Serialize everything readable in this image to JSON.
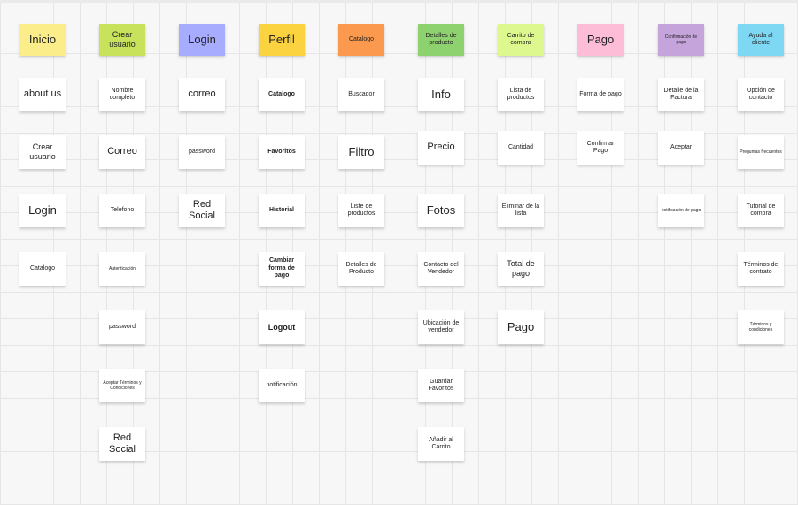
{
  "colors": {
    "inicio": "#fbee8a",
    "crear_usuario": "#c9e25c",
    "login": "#a7acff",
    "perfil": "#fbd23f",
    "catalogo": "#fb9a4e",
    "detalles": "#8ed26f",
    "carrito": "#dcf88e",
    "pago": "#fdbdd6",
    "confirmacion": "#c5a4dc",
    "ayuda": "#7fd8f3",
    "note": "#ffffff"
  },
  "columns": [
    {
      "header": "Inicio",
      "notes": [
        "about us",
        "Crear usuario",
        "Login",
        "Catalogo"
      ]
    },
    {
      "header": "Crear usuario",
      "notes": [
        "Nombre completo",
        "Correo",
        "Telefono",
        "Autenticación",
        "password",
        "Aceptar Términos y Condiciones",
        "Red Social"
      ]
    },
    {
      "header": "Login",
      "notes": [
        "correo",
        "password",
        "Red Social"
      ]
    },
    {
      "header": "Perfil",
      "notes": [
        "Catalogo",
        "Favoritos",
        "Historial",
        "Cambiar forma de pago",
        "Logout",
        "notificación"
      ]
    },
    {
      "header": "Catalogo",
      "notes": [
        "Buscador",
        "Filtro",
        "Liste de productos",
        "Detalles de Producto"
      ]
    },
    {
      "header": "Detalles de producto",
      "notes": [
        "Info",
        "Precio",
        "Fotos",
        "Contacto del Vendedor",
        "Ubicación de vendedor",
        "Guardar Favoritos",
        "Añadir al Carrito"
      ]
    },
    {
      "header": "Carrito de compra",
      "notes": [
        "Lista de productos",
        "Cantidad",
        "Eliminar de la lista",
        "Total de pago",
        "Pago"
      ]
    },
    {
      "header": "Pago",
      "notes": [
        "Forma de pago",
        "Confirmar Pago"
      ]
    },
    {
      "header": "Confirmación de pago",
      "notes": [
        "Detalle de la Factura",
        "Aceptar",
        "notificación de pago"
      ]
    },
    {
      "header": "Ayuda al cliente",
      "notes": [
        "Opción de contacto",
        "Preguntas frecuentes",
        "Tutorial de compra",
        "Términos de contrato",
        "Términos y condiciones"
      ]
    }
  ]
}
